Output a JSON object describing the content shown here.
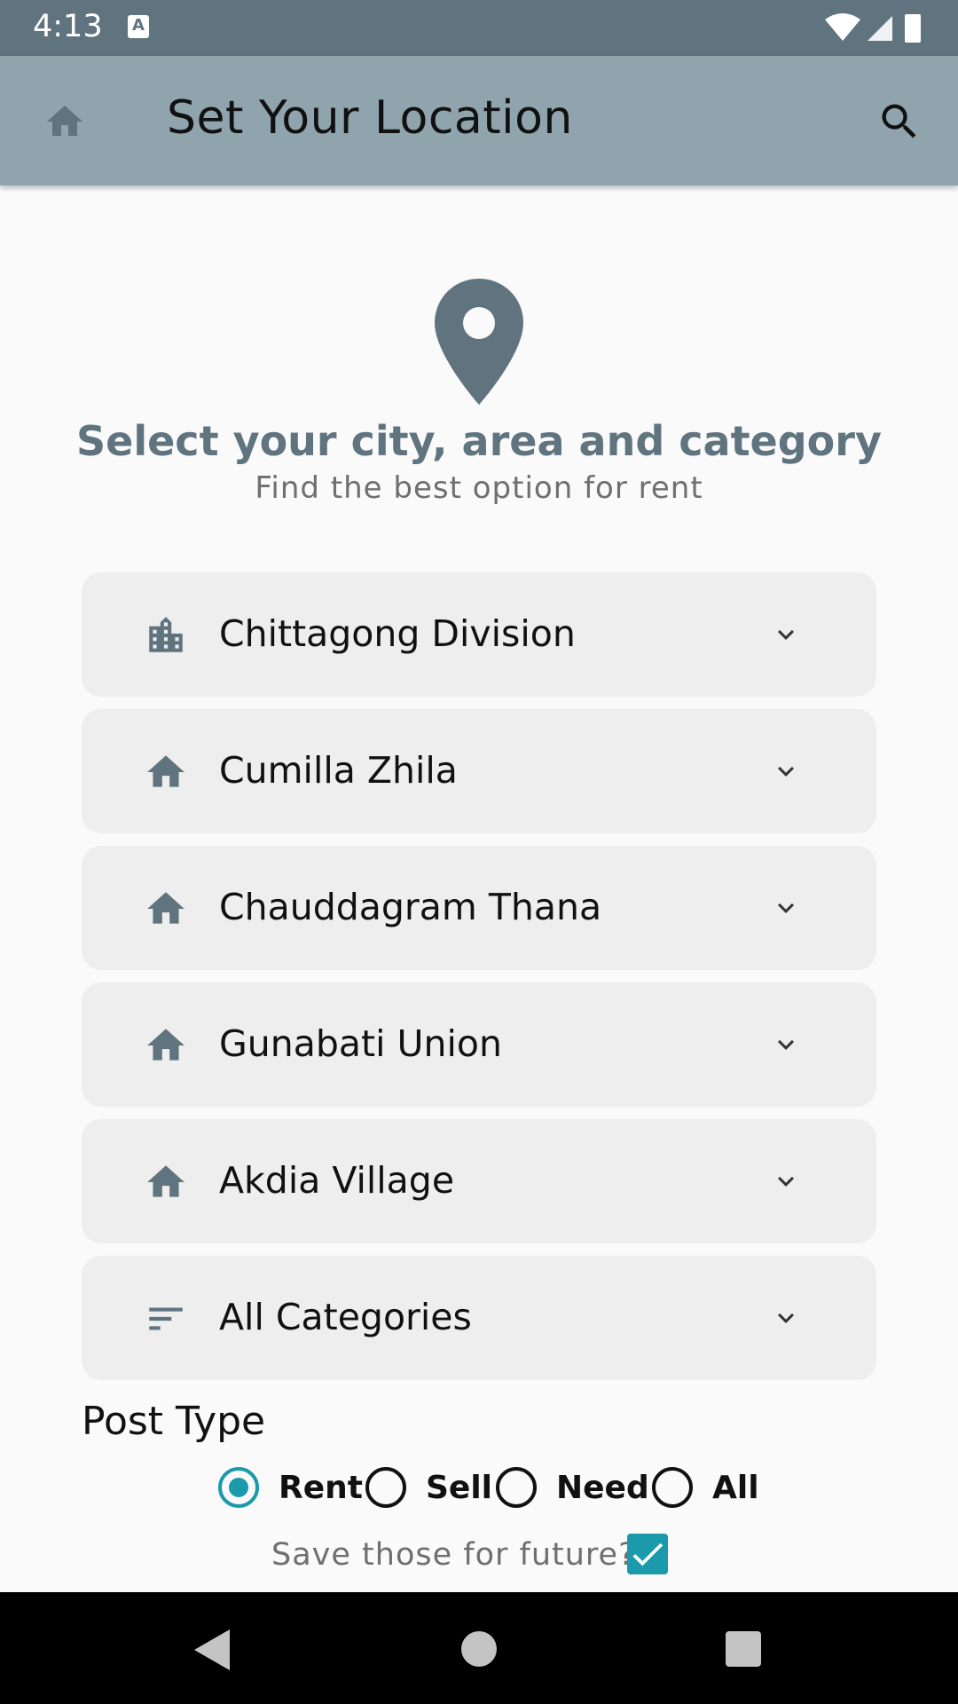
{
  "status_bar": {
    "time": "4:13",
    "notification_icon": "a-letter-icon",
    "icons": [
      "wifi-icon",
      "signal-icon",
      "battery-icon"
    ]
  },
  "app_bar": {
    "title": "Set Your Location",
    "left_icon": "home-icon",
    "right_icon": "search-icon",
    "background": "#90a4ae"
  },
  "hero": {
    "icon": "location-pin-icon",
    "title": "Select your city, area and category",
    "subtitle": "Find the best option for rent"
  },
  "dropdowns": [
    {
      "icon": "city-icon",
      "label": "Chittagong Division"
    },
    {
      "icon": "home-icon",
      "label": "Cumilla Zhila"
    },
    {
      "icon": "home-icon",
      "label": "Chauddagram Thana"
    },
    {
      "icon": "home-icon",
      "label": "Gunabati Union"
    },
    {
      "icon": "home-icon",
      "label": "Akdia Village"
    },
    {
      "icon": "filter-list-icon",
      "label": "All Categories"
    }
  ],
  "post_type": {
    "label": "Post Type",
    "options": [
      {
        "label": "Rent",
        "selected": true
      },
      {
        "label": "Sell",
        "selected": false
      },
      {
        "label": "Need",
        "selected": false
      },
      {
        "label": "All",
        "selected": false
      }
    ]
  },
  "save": {
    "label": "Save those for future?",
    "checked": true
  },
  "colors": {
    "accent": "#1a9aab",
    "icon_gray": "#607480",
    "status_bar": "#607480"
  }
}
